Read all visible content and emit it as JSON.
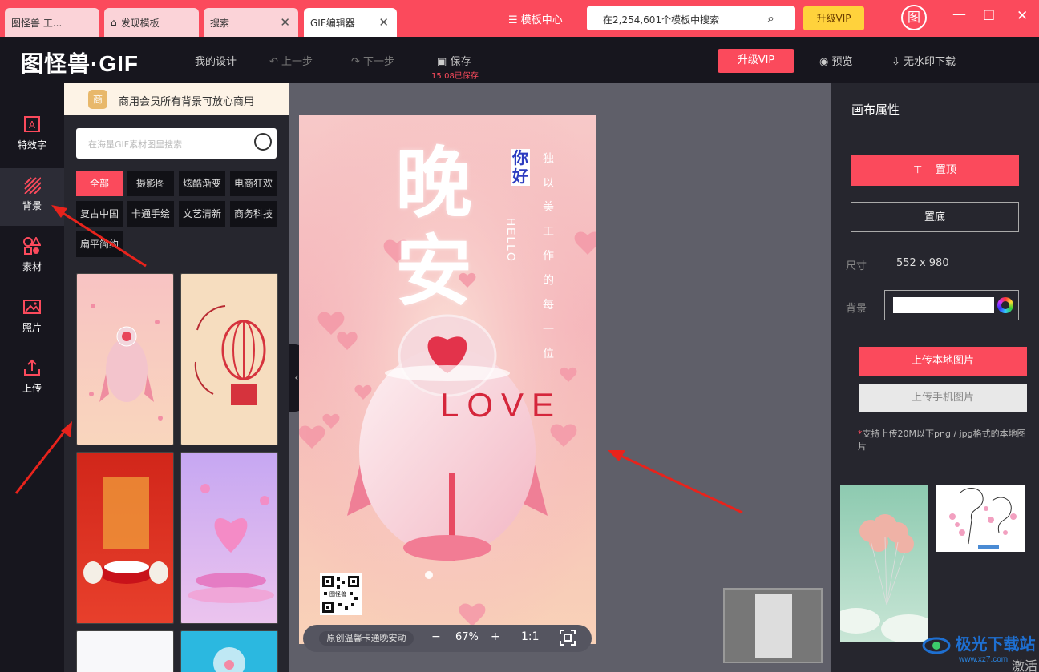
{
  "titlebar": {
    "tabs": [
      {
        "label": "图怪兽 工..."
      },
      {
        "label": "发现模板"
      },
      {
        "label": "搜索"
      },
      {
        "label": "GIF编辑器"
      }
    ],
    "template_center": "模板中心",
    "search_placeholder": "在2,254,601个模板中搜索",
    "upgrade_vip": "升级VIP",
    "logo_char": "图"
  },
  "toolbar": {
    "brand": "图怪兽·GIF",
    "my_designs": "我的设计",
    "undo": "上一步",
    "redo": "下一步",
    "save": "保存",
    "saved_time": "15:08已保存",
    "upgrade_vip": "升级VIP",
    "preview": "预览",
    "download": "无水印下载"
  },
  "leftnav": {
    "items": [
      {
        "label": "特效字",
        "icon": "text-effect-icon"
      },
      {
        "label": "背景",
        "icon": "background-icon",
        "active": true
      },
      {
        "label": "素材",
        "icon": "shapes-icon"
      },
      {
        "label": "照片",
        "icon": "photo-icon"
      },
      {
        "label": "上传",
        "icon": "upload-icon"
      }
    ]
  },
  "panel": {
    "promo": "商用会员所有背景可放心商用",
    "search_placeholder": "在海量GIF素材图里搜索",
    "chips": [
      "全部",
      "摄影图",
      "炫酷渐变",
      "电商狂欢",
      "复古中国",
      "卡通手绘",
      "文艺清新",
      "商务科技",
      "扁平简约"
    ],
    "active_chip": "全部"
  },
  "canvas": {
    "poster": {
      "title": "晚安",
      "greeting": "你好",
      "hello": "HELLO",
      "vertical_text": "独 以 美 工 作 的 每 一 位",
      "love": "LOVE",
      "qr_label": "图怪兽"
    },
    "zoom": {
      "template_name": "原创温馨卡通晚安动",
      "level": "67%",
      "minus": "−",
      "plus": "+",
      "one_to_one": "1:1"
    }
  },
  "rpanel": {
    "title": "画布属性",
    "to_top": "置顶",
    "to_bottom": "置底",
    "size_label": "尺寸",
    "size_value": "552 x 980",
    "bg_label": "背景",
    "upload_local": "上传本地图片",
    "upload_phone": "上传手机图片",
    "note": "支持上传20M以下png / jpg格式的本地图片"
  },
  "watermark": {
    "text": "极光下载站",
    "url": "www.xz7.com",
    "activate": "激活"
  },
  "colors": {
    "accent": "#fb4a5c",
    "dark": "#17161e",
    "panel": "#26262e",
    "canvas_bg": "#5f5f69"
  }
}
